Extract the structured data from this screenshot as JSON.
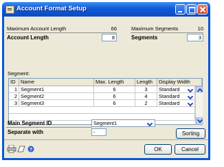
{
  "window": {
    "title": "Account Format Setup"
  },
  "top": {
    "max_account_length_label": "Maximum Account Length",
    "max_account_length_value": "66",
    "account_length_label": "Account Length",
    "account_length_value": "8",
    "max_segments_label": "Maximum Segments",
    "max_segments_value": "10",
    "segments_label": "Segments",
    "segments_value": "3"
  },
  "segment_label": "Segment:",
  "grid": {
    "headers": [
      "ID",
      "Name",
      "Max. Length",
      "Length",
      "Display Width"
    ],
    "rows": [
      {
        "id": "1",
        "name": "Segment1",
        "max_length": "6",
        "length": "3",
        "display_width": "Standard"
      },
      {
        "id": "2",
        "name": "Segment2",
        "max_length": "6",
        "length": "4",
        "display_width": "Standard"
      },
      {
        "id": "3",
        "name": "Segment3",
        "max_length": "6",
        "length": "2",
        "display_width": "Standard"
      }
    ]
  },
  "bottom": {
    "main_segment_label": "Main Segment ID",
    "main_segment_value": "Segment1",
    "separate_with_label": "Separate with",
    "separate_with_value": "-",
    "sorting_button": "Sorting"
  },
  "buttons": {
    "ok": "OK",
    "cancel": "Cancel"
  },
  "icons": [
    "printer-icon",
    "notes-icon",
    "help-icon"
  ]
}
